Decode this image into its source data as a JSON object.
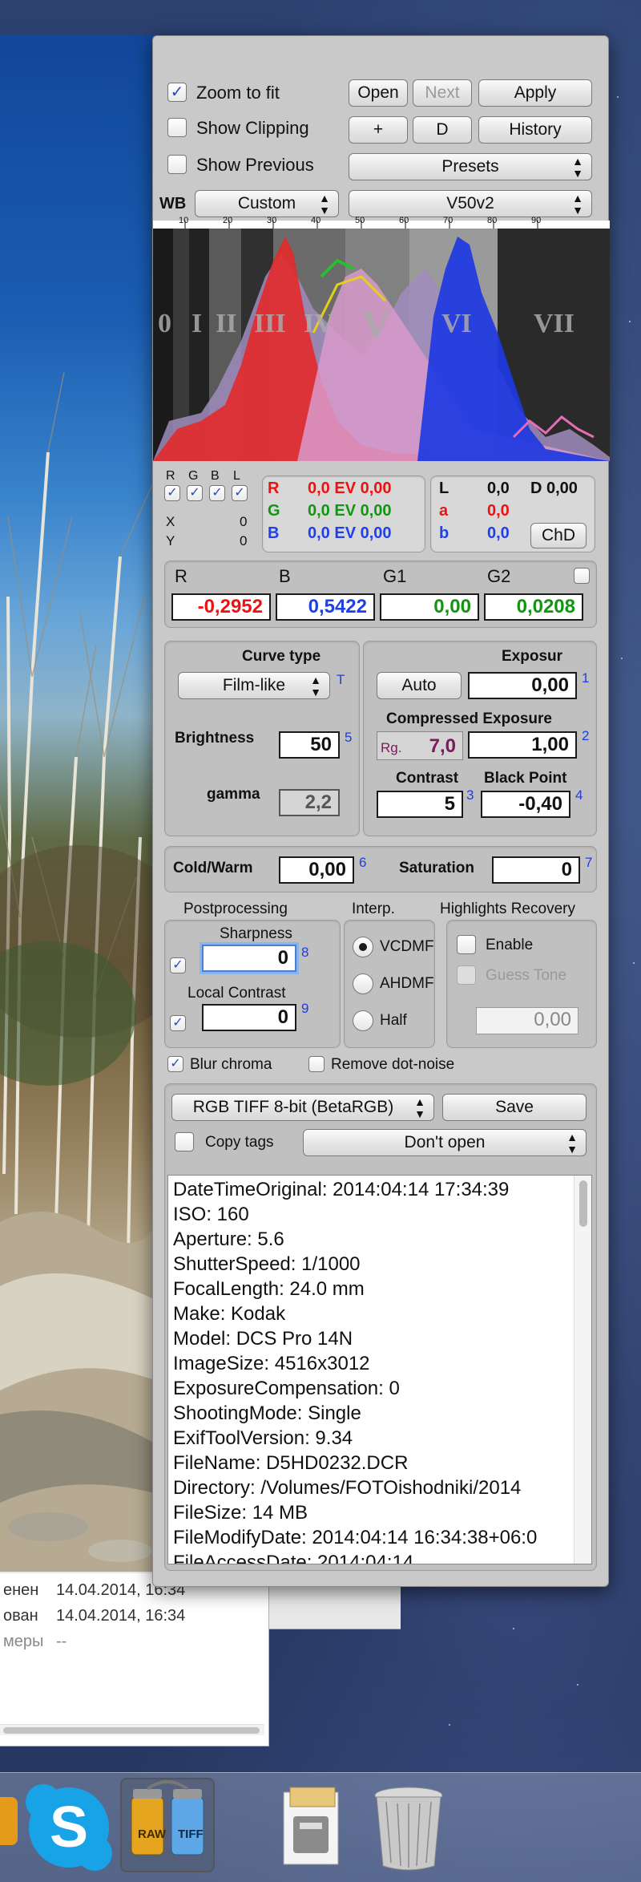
{
  "toolbar": {
    "zoom_to_fit": "Zoom to fit",
    "show_clipping": "Show Clipping",
    "show_previous": "Show Previous",
    "open": "Open",
    "next": "Next",
    "apply": "Apply",
    "plus": "+",
    "d": "D",
    "history": "History",
    "presets": "Presets",
    "wb_label": "WB",
    "wb_value": "Custom",
    "profile_value": "V50v2"
  },
  "histogram": {
    "scale_ticks": [
      "10",
      "20",
      "30",
      "40",
      "50",
      "60",
      "70",
      "80",
      "90"
    ],
    "zones": [
      "0",
      "I",
      "II",
      "III",
      "IV",
      "V",
      "VI",
      "VII"
    ]
  },
  "channels": {
    "labels": [
      "R",
      "G",
      "B",
      "L"
    ],
    "x_label": "X",
    "x_value": "0",
    "y_label": "Y",
    "y_value": "0",
    "rows": [
      {
        "ch": "R",
        "ev": "0,0 EV 0,00"
      },
      {
        "ch": "G",
        "ev": "0,0 EV 0,00"
      },
      {
        "ch": "B",
        "ev": "0,0 EV 0,00"
      }
    ],
    "lab": [
      {
        "ch": "L",
        "value": "0,0"
      },
      {
        "ch": "a",
        "value": "0,0"
      },
      {
        "ch": "b",
        "value": "0,0"
      }
    ],
    "d_value": "D 0,00",
    "chd": "ChD"
  },
  "wb_coeffs": {
    "labels": [
      "R",
      "B",
      "G1",
      "G2"
    ],
    "values": [
      "-0,2952",
      "0,5422",
      "0,00",
      "0,0208"
    ]
  },
  "curve": {
    "title": "Curve type",
    "type_value": "Film-like",
    "tag_t": "T",
    "brightness_label": "Brightness",
    "brightness_value": "50",
    "tag_5": "5",
    "gamma_label": "gamma",
    "gamma_value": "2,2"
  },
  "exposure": {
    "title": "Exposur",
    "auto": "Auto",
    "value": "0,00",
    "tag_1": "1",
    "compressed_label": "Compressed Exposure",
    "rg_label": "Rg.",
    "rg_value": "7,0",
    "compressed_value": "1,00",
    "tag_2": "2",
    "contrast_label": "Contrast",
    "contrast_value": "5",
    "tag_3": "3",
    "black_point_label": "Black Point",
    "black_point_value": "-0,40",
    "tag_4": "4"
  },
  "color": {
    "cold_warm_label": "Cold/Warm",
    "cold_warm_value": "0,00",
    "tag_6": "6",
    "saturation_label": "Saturation",
    "saturation_value": "0",
    "tag_7": "7"
  },
  "postprocessing": {
    "title": "Postprocessing",
    "sharpness_label": "Sharpness",
    "sharpness_value": "0",
    "tag_8": "8",
    "local_contrast_label": "Local Contrast",
    "local_contrast_value": "0",
    "tag_9": "9"
  },
  "interp": {
    "title": "Interp.",
    "options": [
      "VCDMF",
      "AHDMF",
      "Half"
    ],
    "selected": "VCDMF"
  },
  "highlights": {
    "title": "Highlights Recovery",
    "enable": "Enable",
    "guess_tone": "Guess Tone",
    "value": "0,00"
  },
  "options": {
    "blur_chroma": "Blur chroma",
    "remove_dot_noise": "Remove dot-noise"
  },
  "output": {
    "format": "RGB TIFF 8-bit (BetaRGB)",
    "save": "Save",
    "copy_tags": "Copy tags",
    "after_save": "Don't open"
  },
  "exif": [
    "DateTimeOriginal: 2014:04:14 17:34:39",
    "ISO: 160",
    "Aperture: 5.6",
    "ShutterSpeed: 1/1000",
    "FocalLength: 24.0 mm",
    "Make: Kodak",
    "Model: DCS Pro 14N",
    "ImageSize: 4516x3012",
    "ExposureCompensation: 0",
    "ShootingMode: Single",
    "ExifToolVersion: 9.34",
    "FileName: D5HD0232.DCR",
    "Directory: /Volumes/FOTOishodniki/2014",
    "FileSize: 14 MB",
    "FileModifyDate: 2014:04:14 16:34:38+06:0",
    "FileAccessDate: 2014:04:14"
  ],
  "finder": {
    "rows": [
      {
        "k": "енен",
        "v": "14.04.2014, 16:34"
      },
      {
        "k": "ован",
        "v": "14.04.2014, 16:34"
      },
      {
        "k": "меры",
        "v": "--"
      }
    ]
  },
  "dock": {
    "raw_label": "RAW",
    "tiff_label": "TIFF"
  },
  "colors": {
    "red": "#e11111",
    "green": "#129612",
    "blue": "#1f3fe8",
    "tag_blue": "#1c3de0",
    "panel": "#c9c9c9"
  }
}
